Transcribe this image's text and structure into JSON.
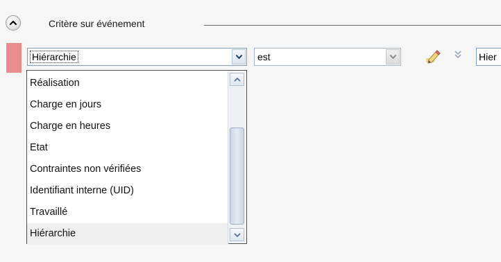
{
  "section": {
    "title": "Critère sur événement",
    "collapse_icon": "chevron-up-icon"
  },
  "criterion_row": {
    "marker_color": "#ec8c8f",
    "field_select": {
      "value": "Hiérarchie",
      "arrow_icon": "chevron-down-icon"
    },
    "operator_select": {
      "value": "est",
      "arrow_icon": "chevron-down-icon"
    },
    "edit_icon": "pencil-edit-icon",
    "expand_icon": "double-chevron-down-icon",
    "value_field": {
      "value": "Hier"
    }
  },
  "dropdown": {
    "items": [
      {
        "label": "Réalisation"
      },
      {
        "label": "Charge en jours"
      },
      {
        "label": "Charge en heures"
      },
      {
        "label": "Etat"
      },
      {
        "label": "Contraintes non vérifiées"
      },
      {
        "label": "Identifiant interne (UID)"
      },
      {
        "label": "Travaillé"
      },
      {
        "label": "Hiérarchie"
      }
    ],
    "selected_label": "Hiérarchie",
    "scroll_up_icon": "chevron-up-icon",
    "scroll_down_icon": "chevron-down-icon"
  }
}
